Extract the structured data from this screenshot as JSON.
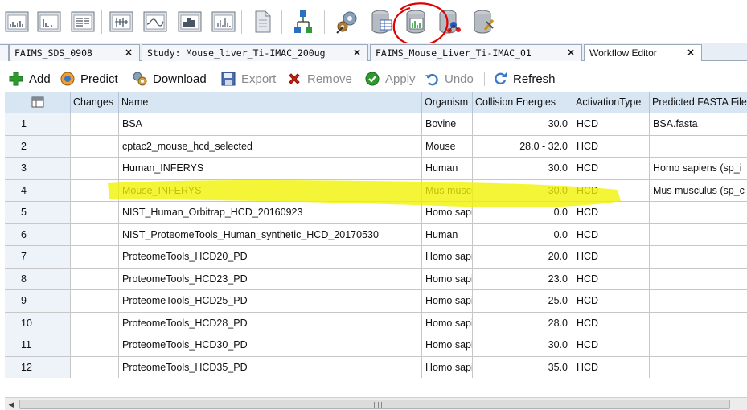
{
  "tabs": [
    {
      "label": "FAIMS_SDS_0908",
      "close": "×"
    },
    {
      "label": "Study: Mouse_liver_Ti-IMAC_200ug",
      "close": "×"
    },
    {
      "label": "FAIMS_Mouse_Liver_Ti-IMAC_01",
      "close": "×"
    },
    {
      "label": "Workflow Editor",
      "close": "×"
    }
  ],
  "actions": {
    "add": "Add",
    "predict": "Predict",
    "download": "Download",
    "export": "Export",
    "remove": "Remove",
    "apply": "Apply",
    "undo": "Undo",
    "refresh": "Refresh"
  },
  "grid": {
    "columns": [
      "Changes",
      "Name",
      "Organism",
      "Collision Energies",
      "ActivationType",
      "Predicted FASTA File"
    ],
    "rows": [
      {
        "n": "1",
        "changes": "",
        "name": "BSA",
        "organism": "Bovine",
        "ce": "30.0",
        "act": "HCD",
        "fasta": "BSA.fasta"
      },
      {
        "n": "2",
        "changes": "",
        "name": "cptac2_mouse_hcd_selected",
        "organism": "Mouse",
        "ce": "28.0 - 32.0",
        "act": "HCD",
        "fasta": ""
      },
      {
        "n": "3",
        "changes": "",
        "name": "Human_INFERYS",
        "organism": "Human",
        "ce": "30.0",
        "act": "HCD",
        "fasta": "Homo sapiens (sp_i"
      },
      {
        "n": "4",
        "changes": "",
        "name": "Mouse_INFERYS",
        "organism": "Mus musculus",
        "ce": "30.0",
        "act": "HCD",
        "fasta": "Mus musculus (sp_c"
      },
      {
        "n": "5",
        "changes": "",
        "name": "NIST_Human_Orbitrap_HCD_20160923",
        "organism": "Homo sapiens",
        "ce": "0.0",
        "act": "HCD",
        "fasta": ""
      },
      {
        "n": "6",
        "changes": "",
        "name": "NIST_ProteomeTools_Human_synthetic_HCD_20170530",
        "organism": "Human",
        "ce": "0.0",
        "act": "HCD",
        "fasta": ""
      },
      {
        "n": "7",
        "changes": "",
        "name": "ProteomeTools_HCD20_PD",
        "organism": "Homo sapiens",
        "ce": "20.0",
        "act": "HCD",
        "fasta": ""
      },
      {
        "n": "8",
        "changes": "",
        "name": "ProteomeTools_HCD23_PD",
        "organism": "Homo sapiens",
        "ce": "23.0",
        "act": "HCD",
        "fasta": ""
      },
      {
        "n": "9",
        "changes": "",
        "name": "ProteomeTools_HCD25_PD",
        "organism": "Homo sapiens",
        "ce": "25.0",
        "act": "HCD",
        "fasta": ""
      },
      {
        "n": "10",
        "changes": "",
        "name": "ProteomeTools_HCD28_PD",
        "organism": "Homo sapiens",
        "ce": "28.0",
        "act": "HCD",
        "fasta": ""
      },
      {
        "n": "11",
        "changes": "",
        "name": "ProteomeTools_HCD30_PD",
        "organism": "Homo sapiens",
        "ce": "30.0",
        "act": "HCD",
        "fasta": ""
      },
      {
        "n": "12",
        "changes": "",
        "name": "ProteomeTools_HCD35_PD",
        "organism": "Homo sapiens",
        "ce": "35.0",
        "act": "HCD",
        "fasta": ""
      }
    ]
  },
  "colors": {
    "header_bg": "#d8e6f4",
    "highlight": "#f2f200",
    "annotation_circle": "#e00000",
    "add_green": "#2e9a2e",
    "remove_red": "#d02010"
  },
  "icons": [
    "report-layout-icon",
    "bar-report-icon",
    "table-report-icon",
    "plot-layout-icon",
    "chromatogram-icon",
    "histogram-icon",
    "spectrum-icon",
    "document-icon",
    "workflow-tree-icon",
    "settings-gears-icon",
    "database-table-icon",
    "spectral-library-icon",
    "database-molecule-icon",
    "database-tools-icon"
  ]
}
